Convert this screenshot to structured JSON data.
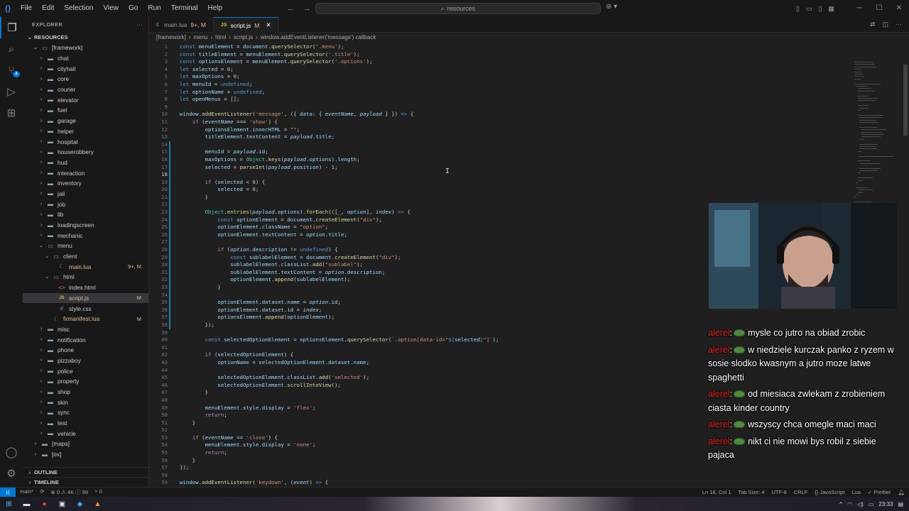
{
  "titlebar": {
    "menu": [
      "File",
      "Edit",
      "Selection",
      "View",
      "Go",
      "Run",
      "Terminal",
      "Help"
    ],
    "search": "resources"
  },
  "sidebar": {
    "header": "EXPLORER",
    "section": "RESOURCES",
    "tree": [
      {
        "label": "[framework]",
        "depth": 1,
        "type": "folder",
        "open": true
      },
      {
        "label": "chat",
        "depth": 2,
        "type": "folder"
      },
      {
        "label": "cityhall",
        "depth": 2,
        "type": "folder"
      },
      {
        "label": "core",
        "depth": 2,
        "type": "folder"
      },
      {
        "label": "courier",
        "depth": 2,
        "type": "folder"
      },
      {
        "label": "elevator",
        "depth": 2,
        "type": "folder"
      },
      {
        "label": "fuel",
        "depth": 2,
        "type": "folder"
      },
      {
        "label": "garage",
        "depth": 2,
        "type": "folder"
      },
      {
        "label": "helper",
        "depth": 2,
        "type": "folder"
      },
      {
        "label": "hospital",
        "depth": 2,
        "type": "folder"
      },
      {
        "label": "houserobbery",
        "depth": 2,
        "type": "folder"
      },
      {
        "label": "hud",
        "depth": 2,
        "type": "folder"
      },
      {
        "label": "interaction",
        "depth": 2,
        "type": "folder"
      },
      {
        "label": "inventory",
        "depth": 2,
        "type": "folder"
      },
      {
        "label": "jail",
        "depth": 2,
        "type": "folder"
      },
      {
        "label": "job",
        "depth": 2,
        "type": "folder"
      },
      {
        "label": "lib",
        "depth": 2,
        "type": "folder"
      },
      {
        "label": "loadingscreen",
        "depth": 2,
        "type": "folder"
      },
      {
        "label": "mechanic",
        "depth": 2,
        "type": "folder"
      },
      {
        "label": "menu",
        "depth": 2,
        "type": "folder",
        "open": true
      },
      {
        "label": "client",
        "depth": 3,
        "type": "folder",
        "open": true
      },
      {
        "label": "main.lua",
        "depth": 4,
        "type": "lua",
        "deco": "9+, M"
      },
      {
        "label": "html",
        "depth": 3,
        "type": "folder",
        "open": true
      },
      {
        "label": "index.html",
        "depth": 4,
        "type": "html"
      },
      {
        "label": "script.js",
        "depth": 4,
        "type": "js",
        "deco": "M",
        "selected": true
      },
      {
        "label": "style.css",
        "depth": 4,
        "type": "css"
      },
      {
        "label": "fxmanifest.lua",
        "depth": 3,
        "type": "lua",
        "deco": "M"
      },
      {
        "label": "misc",
        "depth": 2,
        "type": "folder"
      },
      {
        "label": "notification",
        "depth": 2,
        "type": "folder"
      },
      {
        "label": "phone",
        "depth": 2,
        "type": "folder"
      },
      {
        "label": "pizzaboy",
        "depth": 2,
        "type": "folder"
      },
      {
        "label": "police",
        "depth": 2,
        "type": "folder"
      },
      {
        "label": "property",
        "depth": 2,
        "type": "folder"
      },
      {
        "label": "shop",
        "depth": 2,
        "type": "folder"
      },
      {
        "label": "skin",
        "depth": 2,
        "type": "folder"
      },
      {
        "label": "sync",
        "depth": 2,
        "type": "folder"
      },
      {
        "label": "test",
        "depth": 2,
        "type": "folder"
      },
      {
        "label": "vehicle",
        "depth": 2,
        "type": "folder"
      },
      {
        "label": "[maps]",
        "depth": 1,
        "type": "folder"
      },
      {
        "label": "[ox]",
        "depth": 1,
        "type": "folder"
      }
    ],
    "outline": "OUTLINE",
    "timeline": "TIMELINE"
  },
  "tabs": [
    {
      "label": "main.lua",
      "mod": "9+, M",
      "active": false
    },
    {
      "label": "script.js",
      "mod": "M",
      "active": true
    }
  ],
  "breadcrumb": [
    "[framework]",
    "menu",
    "html",
    "script.js",
    "window.addEventListener('message') callback"
  ],
  "code": [
    {
      "n": "1",
      "h": "<span class='k'>const</span> <span class='v'>menuElement</span> = <span class='v'>document</span>.<span class='f'>querySelector</span>(<span class='s'>'.menu'</span>);"
    },
    {
      "n": "2",
      "h": "<span class='k'>const</span> <span class='v'>titleElement</span> = <span class='v'>menuElement</span>.<span class='f'>querySelector</span>(<span class='s'>'.title'</span>);"
    },
    {
      "n": "3",
      "h": "<span class='k'>const</span> <span class='v'>optionsElement</span> = <span class='v'>menuElement</span>.<span class='f'>querySelector</span>(<span class='s'>'.options'</span>);"
    },
    {
      "n": "4",
      "h": "<span class='k'>let</span> <span class='v'>selected</span> = <span class='n'>0</span>;"
    },
    {
      "n": "5",
      "h": "<span class='k'>let</span> <span class='v'>maxOptions</span> = <span class='n'>0</span>;"
    },
    {
      "n": "6",
      "h": "<span class='k'>let</span> <span class='v'>menuId</span> = <span class='k'>undefined</span>;"
    },
    {
      "n": "7",
      "h": "<span class='k'>let</span> <span class='v'>optionName</span> = <span class='k'>undefined</span>;"
    },
    {
      "n": "8",
      "h": "<span class='k'>let</span> <span class='v'>openMenus</span> = [];"
    },
    {
      "n": "9",
      "h": ""
    },
    {
      "n": "10",
      "h": "<span class='v'>window</span>.<span class='f'>addEventListener</span>(<span class='s'>'message'</span>, ({ <span class='v'>data</span>: { <span class='p'>eventName</span>, <span class='p'>payload</span> } }) <span class='k'>=></span> {"
    },
    {
      "n": "11",
      "h": "    <span class='c'>if</span> (<span class='p'>eventName</span> === <span class='s'>'show'</span>) {"
    },
    {
      "n": "12",
      "h": "        <span class='v'>optionsElement</span>.<span class='v'>innerHTML</span> = <span class='s'>\"\"</span>;"
    },
    {
      "n": "13",
      "h": "        <span class='v'>titleElement</span>.<span class='v'>textContent</span> = <span class='p'>payload</span>.<span class='v'>title</span>;"
    },
    {
      "n": "14",
      "h": ""
    },
    {
      "n": "15",
      "h": "        <span class='v'>menuId</span> = <span class='p'>payload</span>.<span class='v'>id</span>;"
    },
    {
      "n": "16",
      "h": "        <span class='v'>maxOptions</span> = <span class='t'>Object</span>.<span class='f'>keys</span>(<span class='p'>payload</span>.<span class='v'>options</span>).<span class='v'>length</span>;"
    },
    {
      "n": "17",
      "h": "        <span class='v'>selected</span> = <span class='f'>parseInt</span>(<span class='p'>payload</span>.<span class='v'>position</span>) - <span class='n'>1</span>;"
    },
    {
      "n": "18",
      "h": ""
    },
    {
      "n": "19",
      "h": "        <span class='c'>if</span> (<span class='v'>selected</span> &lt; <span class='n'>0</span>) {"
    },
    {
      "n": "20",
      "h": "            <span class='v'>selected</span> = <span class='n'>0</span>;"
    },
    {
      "n": "21",
      "h": "        }"
    },
    {
      "n": "22",
      "h": ""
    },
    {
      "n": "23",
      "h": "        <span class='t'>Object</span>.<span class='f'>entries</span>(<span class='p'>payload</span>.<span class='v'>options</span>).<span class='f'>forEach</span>(([<span class='p'>_</span>, <span class='p'>option</span>], <span class='p'>index</span>) <span class='k'>=></span> {"
    },
    {
      "n": "24",
      "h": "            <span class='k'>const</span> <span class='v'>optionElement</span> = <span class='v'>document</span>.<span class='f'>createElement</span>(<span class='s'>\"div\"</span>);"
    },
    {
      "n": "25",
      "h": "            <span class='v'>optionElement</span>.<span class='v'>className</span> = <span class='s'>\"option\"</span>;"
    },
    {
      "n": "26",
      "h": "            <span class='v'>optionElement</span>.<span class='v'>textContent</span> = <span class='p'>option</span>.<span class='v'>title</span>;"
    },
    {
      "n": "27",
      "h": ""
    },
    {
      "n": "28",
      "h": "            <span class='c'>if</span> (<span class='p'>option</span>.<span class='v'>description</span> != <span class='k'>undefined</span>) {"
    },
    {
      "n": "29",
      "h": "                <span class='k'>const</span> <span class='v'>sublabelElement</span> = <span class='v'>document</span>.<span class='f'>createElement</span>(<span class='s'>\"div\"</span>);"
    },
    {
      "n": "30",
      "h": "                <span class='v'>sublabelElement</span>.<span class='v'>classList</span>.<span class='f'>add</span>(<span class='s'>\"sublabel\"</span>);"
    },
    {
      "n": "31",
      "h": "                <span class='v'>sublabelElement</span>.<span class='v'>textContent</span> = <span class='p'>option</span>.<span class='v'>description</span>;"
    },
    {
      "n": "32",
      "h": "                <span class='v'>optionElement</span>.<span class='f'>append</span>(<span class='v'>sublabelElement</span>);"
    },
    {
      "n": "33",
      "h": "            }"
    },
    {
      "n": "34",
      "h": ""
    },
    {
      "n": "35",
      "h": "            <span class='v'>optionElement</span>.<span class='v'>dataset</span>.<span class='v'>name</span> = <span class='p'>option</span>.<span class='v'>id</span>;"
    },
    {
      "n": "36",
      "h": "            <span class='v'>optionElement</span>.<span class='v'>dataset</span>.<span class='v'>id</span> = <span class='p'>index</span>;"
    },
    {
      "n": "37",
      "h": "            <span class='v'>optionsElement</span>.<span class='f'>append</span>(<span class='v'>optionElement</span>);"
    },
    {
      "n": "38",
      "h": "        });"
    },
    {
      "n": "39",
      "h": ""
    },
    {
      "n": "40",
      "h": "        <span class='k'>const</span> <span class='v'>selectedOptionElement</span> = <span class='v'>optionsElement</span>.<span class='f'>querySelector</span>(<span class='s'>`.option[data-id=\"</span><span class='k'>${</span><span class='v'>selected</span><span class='k'>}</span><span class='s'>\"]`</span>);"
    },
    {
      "n": "41",
      "h": ""
    },
    {
      "n": "42",
      "h": "        <span class='c'>if</span> (<span class='v'>selectedOptionElement</span>) {"
    },
    {
      "n": "43",
      "h": "            <span class='v'>optionName</span> = <span class='v'>selectedOptionElement</span>.<span class='v'>dataset</span>.<span class='v'>name</span>;"
    },
    {
      "n": "44",
      "h": ""
    },
    {
      "n": "45",
      "h": "            <span class='v'>selectedOptionElement</span>.<span class='v'>classList</span>.<span class='f'>add</span>(<span class='s'>'selected'</span>);"
    },
    {
      "n": "46",
      "h": "            <span class='v'>selectedOptionElement</span>.<span class='f'>scrollIntoView</span>();"
    },
    {
      "n": "47",
      "h": "        }"
    },
    {
      "n": "48",
      "h": ""
    },
    {
      "n": "49",
      "h": "        <span class='v'>menuElement</span>.<span class='v'>style</span>.<span class='v'>display</span> = <span class='s'>'flex'</span>;"
    },
    {
      "n": "50",
      "h": "        <span class='c'>return</span>;"
    },
    {
      "n": "51",
      "h": "    }"
    },
    {
      "n": "52",
      "h": ""
    },
    {
      "n": "53",
      "h": "    <span class='c'>if</span> (<span class='p'>eventName</span> == <span class='s'>'close'</span>) {"
    },
    {
      "n": "54",
      "h": "        <span class='v'>menuElement</span>.<span class='v'>style</span>.<span class='v'>display</span> = <span class='s'>'none'</span>;"
    },
    {
      "n": "55",
      "h": "        <span class='c'>return</span>;"
    },
    {
      "n": "56",
      "h": "    }"
    },
    {
      "n": "57",
      "h": "});"
    },
    {
      "n": "58",
      "h": ""
    },
    {
      "n": "59",
      "h": "<span class='v'>window</span>.<span class='f'>addEventListener</span>(<span class='s'>'keydown'</span>, (<span class='p'>event</span>) <span class='k'>=></span> {"
    }
  ],
  "current_line": "18",
  "chat": [
    {
      "user": "alerel",
      "text": "mysle co jutro na obiad zrobic"
    },
    {
      "user": "alerel",
      "text": "w niedziele kurczak panko z ryzem w sosie slodko kwasnym a jutro moze latwe spaghetti"
    },
    {
      "user": "alerel",
      "text": "od miesiaca zwlekam z zrobieniem ciasta kinder country"
    },
    {
      "user": "alerel",
      "text": "wszyscy chca omegle maci maci"
    },
    {
      "user": "alerel",
      "text": "nikt ci nie mowi bys robil z siebie pajaca"
    }
  ],
  "statusbar": {
    "branch": "main*",
    "problems": "⊗ 0 ⚠ 4K ⓘ 99",
    "ports": "⑂ 0",
    "position": "Ln 18, Col 1",
    "tab_size": "Tab Size: 4",
    "encoding": "UTF-8",
    "eol": "CRLF",
    "language": "{} JavaScript",
    "lua": "Lua",
    "prettier": "✓ Prettier"
  },
  "taskbar": {
    "clock": "23:33"
  }
}
